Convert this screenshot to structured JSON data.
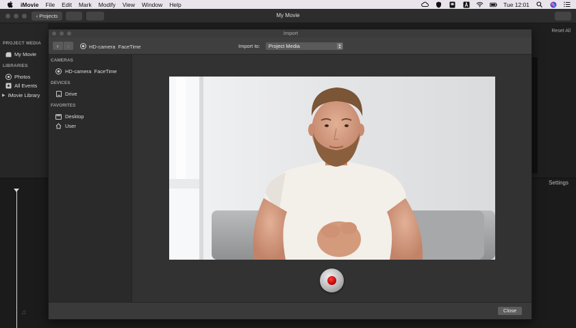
{
  "menubar": {
    "app_name": "iMovie",
    "items": [
      "File",
      "Edit",
      "Mark",
      "Modify",
      "View",
      "Window",
      "Help"
    ],
    "clock": "Tue 12:01",
    "status_icons": [
      "cloud-icon",
      "shield-icon",
      "flag-icon",
      "a-icon",
      "wifi-icon",
      "battery-icon",
      "search-icon",
      "siri-icon",
      "list-icon"
    ]
  },
  "window": {
    "title": "My Movie",
    "projects_button": "Projects",
    "reset_all": "Reset All",
    "settings": "Settings"
  },
  "library": {
    "project_media_header": "PROJECT MEDIA",
    "project_item": "My Movie",
    "libraries_header": "LIBRARIES",
    "items": [
      "Photos",
      "All Events",
      "iMovie Library"
    ]
  },
  "import_dialog": {
    "title": "Import",
    "source_label": "HD-camera  FaceTime",
    "import_to_label": "Import to:",
    "import_to_value": "Project Media",
    "sidebar": {
      "cameras_header": "CAMERAS",
      "camera_item": "HD-camera  FaceTime",
      "devices_header": "DEVICES",
      "device_item": "Drive",
      "favorites_header": "FAVORITES",
      "favorites": [
        "Desktop",
        "User"
      ]
    },
    "close_button": "Close"
  }
}
